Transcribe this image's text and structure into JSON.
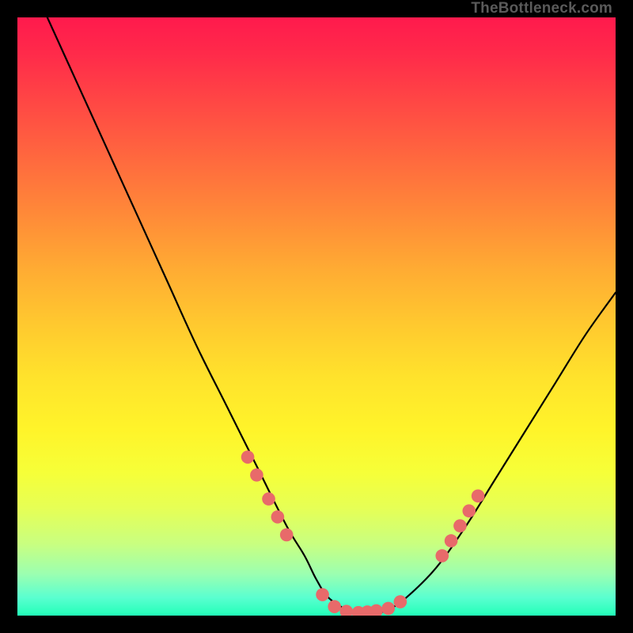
{
  "watermark": "TheBottleneck.com",
  "chart_data": {
    "type": "line",
    "title": "",
    "xlabel": "",
    "ylabel": "",
    "xlim": [
      0,
      100
    ],
    "ylim": [
      0,
      100
    ],
    "grid": false,
    "legend": false,
    "series": [
      {
        "name": "curve",
        "x": [
          5,
          10,
          15,
          20,
          25,
          30,
          35,
          40,
          45,
          48,
          50,
          52,
          55,
          57,
          60,
          62,
          65,
          70,
          75,
          80,
          85,
          90,
          95,
          100
        ],
        "y": [
          100,
          89,
          78,
          67,
          56,
          45,
          35,
          25,
          15,
          10,
          6,
          3,
          1,
          0.5,
          0.5,
          1,
          3,
          8,
          15,
          23,
          31,
          39,
          47,
          54
        ]
      }
    ],
    "markers": {
      "name": "dots",
      "color": "#e86a6a",
      "radius_pct": 1.1,
      "points": [
        {
          "x": 38.5,
          "y": 26.5
        },
        {
          "x": 40.0,
          "y": 23.5
        },
        {
          "x": 42.0,
          "y": 19.5
        },
        {
          "x": 43.5,
          "y": 16.5
        },
        {
          "x": 45.0,
          "y": 13.5
        },
        {
          "x": 51.0,
          "y": 3.5
        },
        {
          "x": 53.0,
          "y": 1.5
        },
        {
          "x": 55.0,
          "y": 0.7
        },
        {
          "x": 57.0,
          "y": 0.5
        },
        {
          "x": 58.5,
          "y": 0.6
        },
        {
          "x": 60.0,
          "y": 0.8
        },
        {
          "x": 62.0,
          "y": 1.2
        },
        {
          "x": 64.0,
          "y": 2.3
        },
        {
          "x": 71.0,
          "y": 10.0
        },
        {
          "x": 72.5,
          "y": 12.5
        },
        {
          "x": 74.0,
          "y": 15.0
        },
        {
          "x": 75.5,
          "y": 17.5
        },
        {
          "x": 77.0,
          "y": 20.0
        }
      ]
    }
  }
}
